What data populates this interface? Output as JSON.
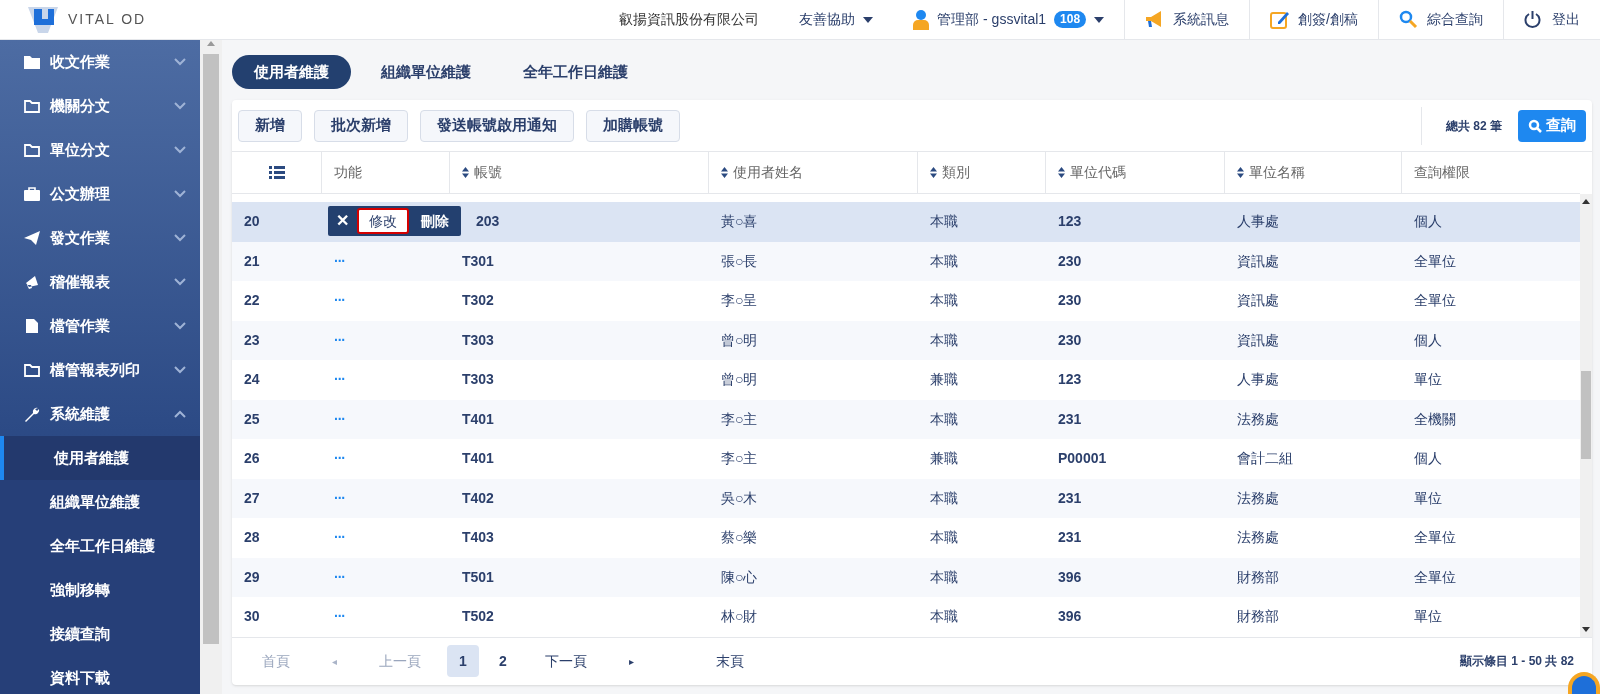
{
  "logo": {
    "text": "VITAL OD"
  },
  "header": {
    "company": "叡揚資訊股份有限公司",
    "help": "友善協助",
    "user": "管理部 - gssvital1",
    "badge": "108",
    "actions": [
      {
        "label": "系統訊息"
      },
      {
        "label": "創簽/創稿"
      },
      {
        "label": "綜合查詢"
      },
      {
        "label": "登出"
      }
    ]
  },
  "sidebar": {
    "items": [
      {
        "label": "收文作業",
        "expanded": false
      },
      {
        "label": "機關分文",
        "expanded": false
      },
      {
        "label": "單位分文",
        "expanded": false
      },
      {
        "label": "公文辦理",
        "expanded": false
      },
      {
        "label": "發文作業",
        "expanded": false
      },
      {
        "label": "稽催報表",
        "expanded": false
      },
      {
        "label": "檔管作業",
        "expanded": false
      },
      {
        "label": "檔管報表列印",
        "expanded": false
      },
      {
        "label": "系統維護",
        "expanded": true,
        "children": [
          {
            "label": "使用者維護",
            "selected": true
          },
          {
            "label": "組織單位維護",
            "selected": false
          },
          {
            "label": "全年工作日維護",
            "selected": false
          },
          {
            "label": "強制移轉",
            "selected": false
          },
          {
            "label": "接續查詢",
            "selected": false
          },
          {
            "label": "資料下載",
            "selected": false
          }
        ]
      }
    ]
  },
  "tabs": [
    {
      "label": "使用者維護",
      "selected": true
    },
    {
      "label": "組織單位維護",
      "selected": false
    },
    {
      "label": "全年工作日維護",
      "selected": false
    }
  ],
  "toolbar": {
    "buttons": [
      "新增",
      "批次新增",
      "發送帳號啟用通知",
      "加購帳號"
    ],
    "total": "總共 82 筆",
    "search_button": "查詢"
  },
  "table": {
    "columns": [
      {
        "kind": "icon"
      },
      {
        "kind": "text",
        "label": "功能",
        "sortable": false
      },
      {
        "label": "帳號",
        "sortable": true
      },
      {
        "label": "使用者姓名",
        "sortable": true
      },
      {
        "label": "類別",
        "sortable": true
      },
      {
        "label": "單位代碼",
        "sortable": true
      },
      {
        "label": "單位名稱",
        "sortable": true
      },
      {
        "label": "查詢權限",
        "sortable": false
      }
    ],
    "rows": [
      {
        "selected": true,
        "cells": [
          "20",
          {
            "kind": "menu",
            "close": "✕",
            "items": [
              {
                "label": "修改",
                "focused": true
              },
              {
                "label": "刪除",
                "focused": false
              }
            ]
          },
          "203",
          "黃○喜",
          "本職",
          "123",
          "人事處",
          "個人"
        ]
      },
      {
        "selected": false,
        "cells": [
          "21",
          {
            "kind": "more",
            "label": "···"
          },
          "T301",
          "張○長",
          "本職",
          "230",
          "資訊處",
          "全單位"
        ]
      },
      {
        "selected": false,
        "cells": [
          "22",
          {
            "kind": "more",
            "label": "···"
          },
          "T302",
          "李○呈",
          "本職",
          "230",
          "資訊處",
          "全單位"
        ]
      },
      {
        "selected": false,
        "cells": [
          "23",
          {
            "kind": "more",
            "label": "···"
          },
          "T303",
          "曾○明",
          "本職",
          "230",
          "資訊處",
          "個人"
        ]
      },
      {
        "selected": false,
        "cells": [
          "24",
          {
            "kind": "more",
            "label": "···"
          },
          "T303",
          "曾○明",
          "兼職",
          "123",
          "人事處",
          "單位"
        ]
      },
      {
        "selected": false,
        "cells": [
          "25",
          {
            "kind": "more",
            "label": "···"
          },
          "T401",
          "李○主",
          "本職",
          "231",
          "法務處",
          "全機關"
        ]
      },
      {
        "selected": false,
        "cells": [
          "26",
          {
            "kind": "more",
            "label": "···"
          },
          "T401",
          "李○主",
          "兼職",
          "P00001",
          "會計二組",
          "個人"
        ]
      },
      {
        "selected": false,
        "cells": [
          "27",
          {
            "kind": "more",
            "label": "···"
          },
          "T402",
          "吳○木",
          "本職",
          "231",
          "法務處",
          "單位"
        ]
      },
      {
        "selected": false,
        "cells": [
          "28",
          {
            "kind": "more",
            "label": "···"
          },
          "T403",
          "蔡○樂",
          "本職",
          "231",
          "法務處",
          "全單位"
        ]
      },
      {
        "selected": false,
        "cells": [
          "29",
          {
            "kind": "more",
            "label": "···"
          },
          "T501",
          "陳○心",
          "本職",
          "396",
          "財務部",
          "全單位"
        ]
      },
      {
        "selected": false,
        "cells": [
          "30",
          {
            "kind": "more",
            "label": "···"
          },
          "T502",
          "林○財",
          "本職",
          "396",
          "財務部",
          "單位"
        ]
      }
    ]
  },
  "pagination": {
    "items": [
      {
        "kind": "text",
        "label": "首頁",
        "disabled": true
      },
      {
        "kind": "prev",
        "label": "◂",
        "disabled": true
      },
      {
        "kind": "text",
        "label": "上一頁",
        "disabled": true
      },
      {
        "kind": "page",
        "label": "1",
        "selected": true
      },
      {
        "kind": "page",
        "label": "2",
        "selected": false
      },
      {
        "kind": "text",
        "label": "下一頁",
        "disabled": false
      },
      {
        "kind": "next",
        "label": "▸",
        "disabled": false
      },
      {
        "kind": "text",
        "label": "末頁",
        "disabled": false
      }
    ],
    "summary": "顯示條目 1 - 50 共 82"
  }
}
